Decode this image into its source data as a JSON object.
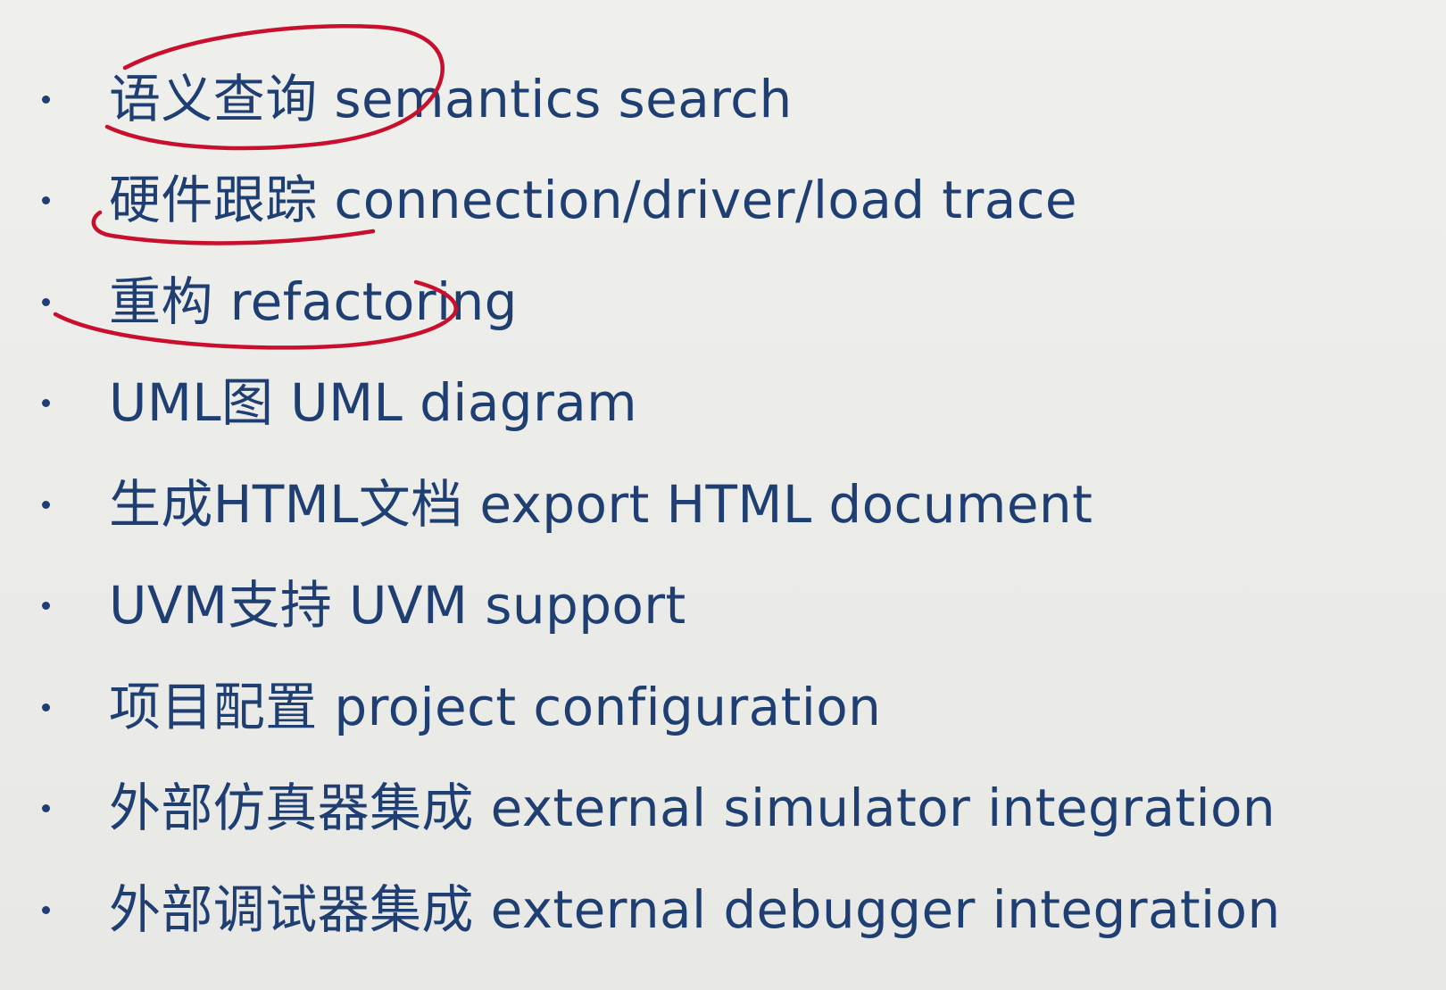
{
  "items": [
    {
      "text": "语义查询 semantics search"
    },
    {
      "text": "硬件跟踪 connection/driver/load trace"
    },
    {
      "text": "重构 refactoring"
    },
    {
      "text": "UML图 UML diagram"
    },
    {
      "text": "生成HTML文档 export HTML document"
    },
    {
      "text": "UVM支持 UVM support"
    },
    {
      "text": "项目配置 project configuration"
    },
    {
      "text": "外部仿真器集成 external simulator integration"
    },
    {
      "text": "外部调试器集成 external debugger integration"
    }
  ],
  "colors": {
    "text": "#1f3f73",
    "background": "#ececea",
    "annotation": "#c8102e"
  }
}
